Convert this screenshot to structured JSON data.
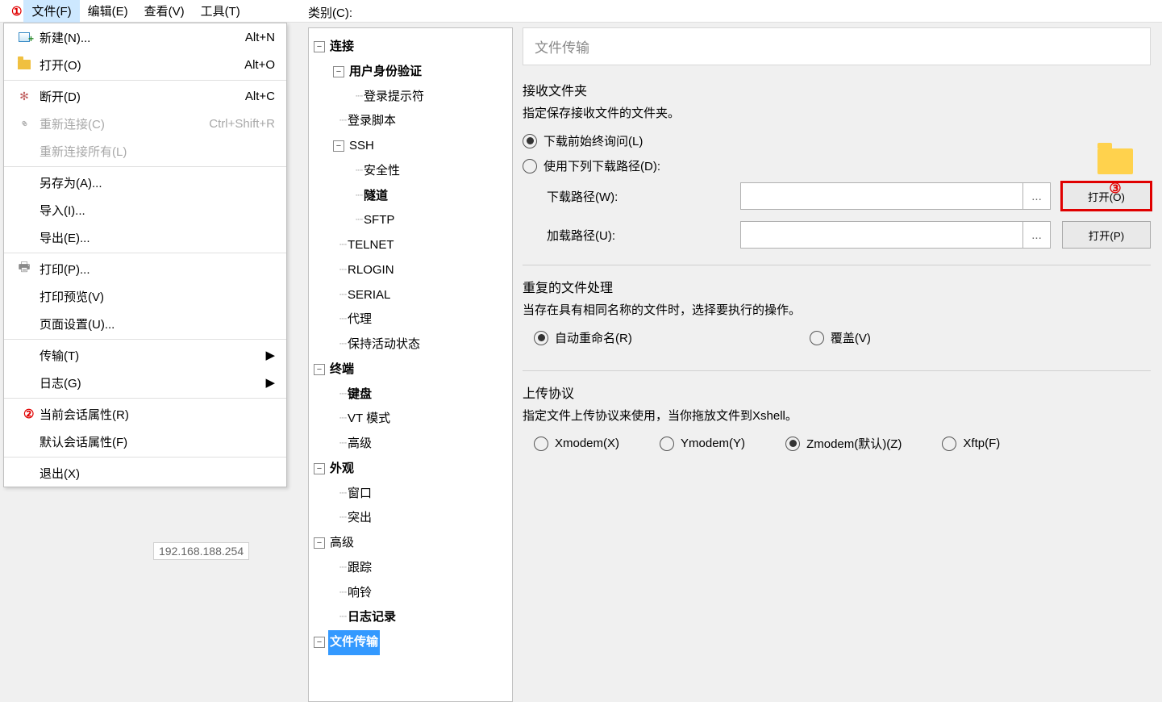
{
  "annot": {
    "one": "①",
    "two": "②",
    "three": "③"
  },
  "menubar": {
    "file": "文件(F)",
    "edit": "编辑(E)",
    "view": "查看(V)",
    "tools": "工具(T)"
  },
  "dropdown": {
    "new": "新建(N)...",
    "new_sc": "Alt+N",
    "open": "打开(O)",
    "open_sc": "Alt+O",
    "disconnect": "断开(D)",
    "disconnect_sc": "Alt+C",
    "reconnect": "重新连接(C)",
    "reconnect_sc": "Ctrl+Shift+R",
    "reconnect_all": "重新连接所有(L)",
    "save_as": "另存为(A)...",
    "import": "导入(I)...",
    "export": "导出(E)...",
    "print": "打印(P)...",
    "print_preview": "打印预览(V)",
    "page_setup": "页面设置(U)...",
    "transfer": "传输(T)",
    "log": "日志(G)",
    "current_session_props": "当前会话属性(R)",
    "default_session_props": "默认会话属性(F)",
    "exit": "退出(X)"
  },
  "categories_label": "类别(C):",
  "tree": {
    "connection": "连接",
    "user_auth": "用户身份验证",
    "login_prompt": "登录提示符",
    "login_script": "登录脚本",
    "ssh": "SSH",
    "security": "安全性",
    "tunnel": "隧道",
    "sftp": "SFTP",
    "telnet": "TELNET",
    "rlogin": "RLOGIN",
    "serial": "SERIAL",
    "proxy": "代理",
    "keepalive": "保持活动状态",
    "terminal": "终端",
    "keyboard": "键盘",
    "vt_mode": "VT 模式",
    "advanced_term": "高级",
    "appearance": "外观",
    "window": "窗口",
    "highlight": "突出",
    "advanced": "高级",
    "trace": "跟踪",
    "bell": "响铃",
    "logging": "日志记录",
    "file_transfer": "文件传输"
  },
  "panel": {
    "title": "文件传输",
    "recv_folder": "接收文件夹",
    "recv_desc": "指定保存接收文件的文件夹。",
    "always_ask": "下载前始终询问(L)",
    "use_path": "使用下列下载路径(D):",
    "download_path": "下载路径(W):",
    "load_path": "加载路径(U):",
    "browse": "...",
    "open_o": "打开(O)",
    "open_p": "打开(P)",
    "dup_title": "重复的文件处理",
    "dup_desc": "当存在具有相同名称的文件时，选择要执行的操作。",
    "auto_rename": "自动重命名(R)",
    "overwrite": "覆盖(V)",
    "upload_title": "上传协议",
    "upload_desc": "指定文件上传协议来使用，当你拖放文件到Xshell。",
    "xmodem": "Xmodem(X)",
    "ymodem": "Ymodem(Y)",
    "zmodem": "Zmodem(默认)(Z)",
    "xftp": "Xftp(F)"
  },
  "leftover_ip": "192.168.188.254",
  "arrow": "▶"
}
